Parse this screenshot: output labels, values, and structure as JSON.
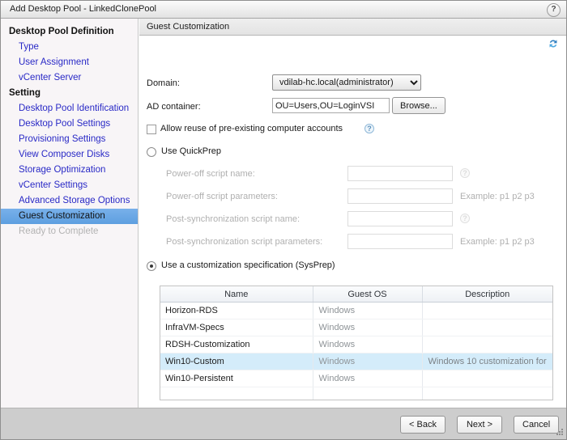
{
  "window": {
    "title": "Add Desktop Pool - LinkedClonePool",
    "help_icon": "?"
  },
  "sidebar": {
    "groups": [
      {
        "heading": "Desktop Pool Definition",
        "items": [
          {
            "label": "Type",
            "state": "link"
          },
          {
            "label": "User Assignment",
            "state": "link"
          },
          {
            "label": "vCenter Server",
            "state": "link"
          }
        ]
      },
      {
        "heading": "Setting",
        "items": [
          {
            "label": "Desktop Pool Identification",
            "state": "link"
          },
          {
            "label": "Desktop Pool Settings",
            "state": "link"
          },
          {
            "label": "Provisioning Settings",
            "state": "link"
          },
          {
            "label": "View Composer Disks",
            "state": "link"
          },
          {
            "label": "Storage Optimization",
            "state": "link"
          },
          {
            "label": "vCenter Settings",
            "state": "link"
          },
          {
            "label": "Advanced Storage Options",
            "state": "link"
          },
          {
            "label": "Guest Customization",
            "state": "selected"
          },
          {
            "label": "Ready to Complete",
            "state": "disabled"
          }
        ]
      }
    ]
  },
  "panel": {
    "header_title": "Guest Customization",
    "refresh_icon": "refresh-icon"
  },
  "form": {
    "domain_label": "Domain:",
    "domain_value": "vdilab-hc.local(administrator)",
    "domain_options": [
      "vdilab-hc.local(administrator)"
    ],
    "ad_container_label": "AD container:",
    "ad_container_value": "OU=Users,OU=LoginVSI",
    "ad_container_placeholder": "",
    "browse_label": "Browse...",
    "allow_reuse_label": "Allow reuse of pre-existing computer accounts",
    "allow_reuse_checked": false,
    "allow_reuse_help": "?",
    "quickprep_label": "Use QuickPrep",
    "quickprep_selected": false,
    "sysprep_label": "Use a customization specification (SysPrep)",
    "sysprep_selected": true,
    "script_fields": [
      {
        "label": "Power-off script name:",
        "value": "",
        "trailing_type": "help",
        "trailing_text": "?"
      },
      {
        "label": "Power-off script parameters:",
        "value": "",
        "trailing_type": "example",
        "trailing_text": "Example: p1 p2 p3"
      },
      {
        "label": "Post-synchronization script name:",
        "value": "",
        "trailing_type": "help",
        "trailing_text": "?"
      },
      {
        "label": "Post-synchronization script parameters:",
        "value": "",
        "trailing_type": "example",
        "trailing_text": "Example: p1 p2 p3"
      }
    ]
  },
  "spec_table": {
    "columns": [
      "Name",
      "Guest OS",
      "Description"
    ],
    "rows": [
      {
        "name": "Horizon-RDS",
        "os": "Windows",
        "description": "",
        "selected": false
      },
      {
        "name": "InfraVM-Specs",
        "os": "Windows",
        "description": "",
        "selected": false
      },
      {
        "name": "RDSH-Customization",
        "os": "Windows",
        "description": "",
        "selected": false
      },
      {
        "name": "Win10-Custom",
        "os": "Windows",
        "description": "Windows 10 customization for",
        "selected": true
      },
      {
        "name": "Win10-Persistent",
        "os": "Windows",
        "description": "",
        "selected": false
      }
    ],
    "empty_rows": 2
  },
  "footer": {
    "back_label": "< Back",
    "next_label": "Next >",
    "cancel_label": "Cancel"
  }
}
